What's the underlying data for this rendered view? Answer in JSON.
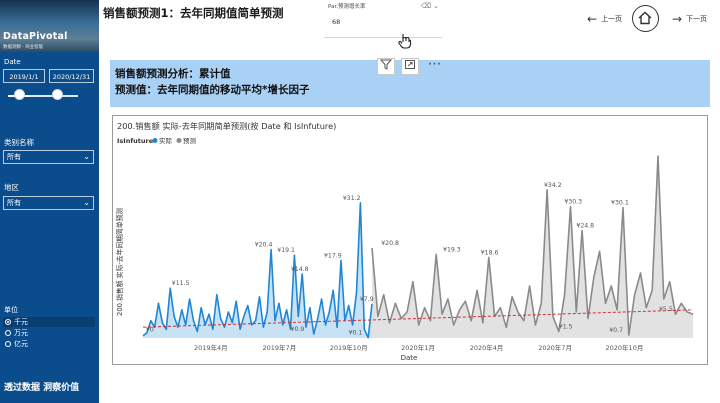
{
  "sidebar": {
    "brand": "DataPivotal",
    "brand_tagline": "数据洞察 · 商业智能",
    "date_label": "Date",
    "date_start": "2019/1/1",
    "date_end": "2020/12/31",
    "date_slider": {
      "start_fraction": 0.08,
      "end_fraction": 0.7
    },
    "category_label": "类别名称",
    "category_value": "所有",
    "region_label": "地区",
    "region_value": "所有",
    "unit_label": "单位",
    "units": [
      "千元",
      "万元",
      "亿元"
    ],
    "unit_selected": "千元",
    "slogan": "透过数据 洞察价值"
  },
  "header": {
    "title": "销售额预测1：去年同期值简单预测",
    "param_label": "Par.预测增长率",
    "param_value": "68",
    "prev_label": "上一页",
    "next_label": "下一页"
  },
  "banner": {
    "line1": "销售额预测分析：累计值",
    "line2": "预测值：去年同期值的移动平均*增长因子"
  },
  "icons": {
    "filter": "filter-icon",
    "focus": "focus-mode-icon",
    "more": "more-options-icon",
    "home": "home-icon",
    "cursor": "hand-cursor-icon"
  },
  "colors": {
    "sidebar": "#0b4d8c",
    "banner": "#a9d0f5",
    "actual": "#1f87d6",
    "forecast": "#8a8a8a",
    "trend": "#d32f2f"
  },
  "chart_data": {
    "type": "line",
    "title": "200.销售额 实际-去年同期简单预测(按 Date 和 IsInfuture)",
    "legend_title": "IsInfuture",
    "series": [
      {
        "name": "实际",
        "color": "#1f87d6"
      },
      {
        "name": "预测",
        "color": "#8a8a8a"
      }
    ],
    "xlabel": "Date",
    "ylabel": "200.销售额 实际-去年同期简单预测",
    "x_ticks": [
      "2019年4月",
      "2019年7月",
      "2019年10月",
      "2020年1月",
      "2020年4月",
      "2020年7月",
      "2020年10月"
    ],
    "x_range": [
      "2019-01-01",
      "2020-12-31"
    ],
    "y_range": [
      0,
      42
    ],
    "annotations": [
      {
        "label": "¥0",
        "x": "2019-01-10",
        "y": 0.8
      },
      {
        "label": "¥11.5",
        "x": "2019-02-20",
        "y": 11.5
      },
      {
        "label": "¥20.4",
        "x": "2019-06-10",
        "y": 20.4
      },
      {
        "label": "¥19.1",
        "x": "2019-07-10",
        "y": 19.1
      },
      {
        "label": "¥14.8",
        "x": "2019-07-28",
        "y": 14.8
      },
      {
        "label": "¥0.9",
        "x": "2019-07-25",
        "y": 0.9
      },
      {
        "label": "¥17.9",
        "x": "2019-09-10",
        "y": 17.9
      },
      {
        "label": "¥31.2",
        "x": "2019-10-05",
        "y": 31.2
      },
      {
        "label": "¥0.1",
        "x": "2019-10-10",
        "y": 0.1
      },
      {
        "label": "¥7.9",
        "x": "2019-10-25",
        "y": 7.9
      },
      {
        "label": "¥20.8",
        "x": "2019-11-25",
        "y": 20.8
      },
      {
        "label": "¥19.3",
        "x": "2020-02-15",
        "y": 19.3
      },
      {
        "label": "¥18.6",
        "x": "2020-04-05",
        "y": 18.6
      },
      {
        "label": "¥34.2",
        "x": "2020-06-28",
        "y": 34.2
      },
      {
        "label": "¥30.3",
        "x": "2020-07-25",
        "y": 30.3
      },
      {
        "label": "¥24.8",
        "x": "2020-08-10",
        "y": 24.8
      },
      {
        "label": "¥1.5",
        "x": "2020-07-15",
        "y": 1.5
      },
      {
        "label": "¥30.1",
        "x": "2020-09-25",
        "y": 30.1
      },
      {
        "label": "¥0.7",
        "x": "2020-09-20",
        "y": 0.7
      },
      {
        "label": "¥5.5",
        "x": "2020-11-25",
        "y": 5.5
      }
    ],
    "split_date": "2019-11-01",
    "actual_values": [
      0.5,
      1.2,
      4.0,
      2.5,
      8.0,
      3.5,
      2.0,
      11.5,
      5.0,
      2.5,
      6.5,
      3.0,
      9.0,
      4.0,
      1.5,
      7.0,
      3.0,
      5.5,
      2.0,
      10.0,
      4.5,
      2.5,
      6.0,
      3.5,
      8.5,
      2.0,
      5.0,
      7.5,
      3.0,
      4.0,
      9.5,
      2.5,
      6.0,
      20.4,
      4.0,
      8.0,
      3.0,
      6.5,
      2.0,
      19.1,
      5.0,
      14.8,
      2.5,
      7.0,
      0.9,
      4.5,
      9.0,
      3.0,
      6.0,
      11.0,
      2.5,
      17.9,
      4.0,
      7.5,
      3.0,
      10.5,
      31.2,
      2.0,
      0.1,
      7.9
    ],
    "forecast_values": [
      20.8,
      5.0,
      10.0,
      3.5,
      8.0,
      4.5,
      6.0,
      13.0,
      3.0,
      7.0,
      4.0,
      19.3,
      5.5,
      9.0,
      3.0,
      6.5,
      8.5,
      4.0,
      11.0,
      3.5,
      18.6,
      5.0,
      7.0,
      2.5,
      9.5,
      6.0,
      4.0,
      12.0,
      3.0,
      8.0,
      34.2,
      5.0,
      1.5,
      10.0,
      30.3,
      6.0,
      24.8,
      4.5,
      14.0,
      20.0,
      8.0,
      12.0,
      6.5,
      30.1,
      0.7,
      10.0,
      15.0,
      7.0,
      11.0,
      42.0,
      9.0,
      13.0,
      5.5,
      8.0,
      6.0,
      5.5
    ],
    "trend": {
      "start": 2.5,
      "end": 6.5
    },
    "legend_position": "top-left",
    "grid": false
  }
}
